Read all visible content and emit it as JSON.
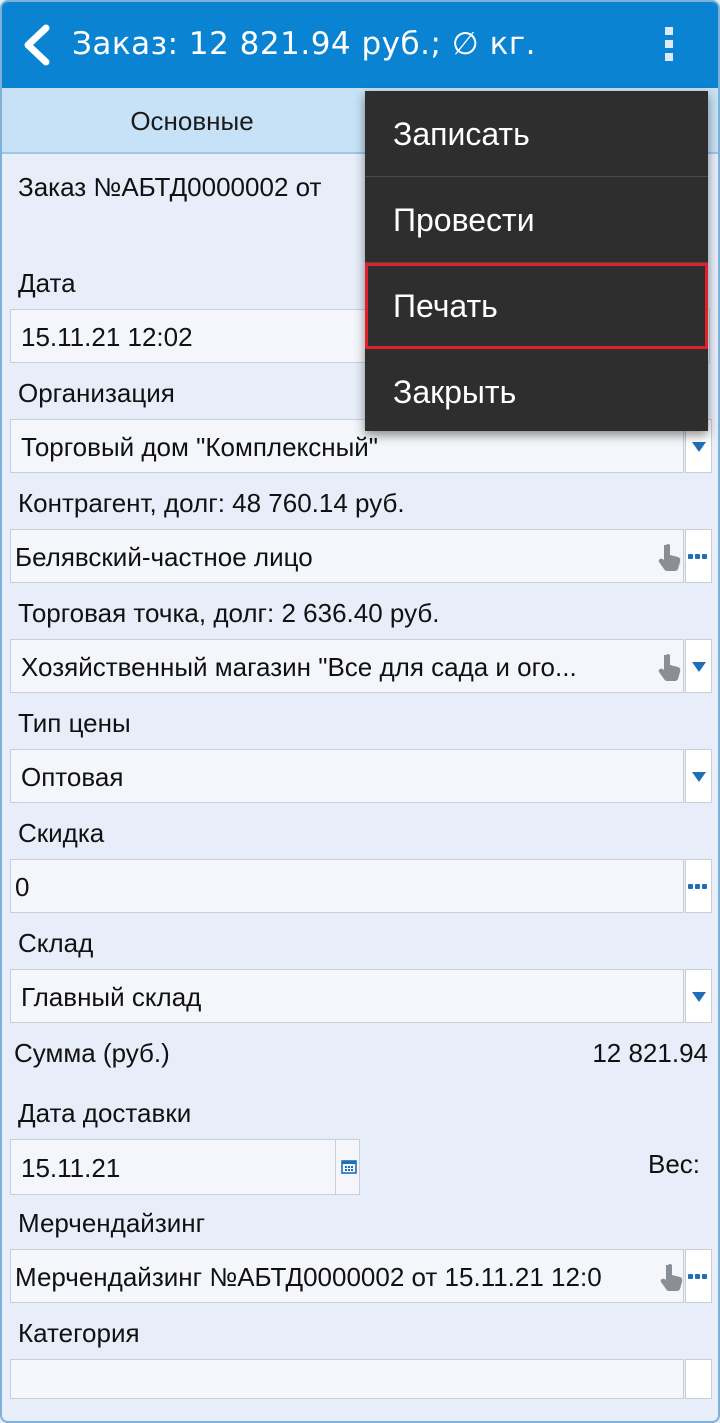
{
  "appbar": {
    "title": "Заказ: 12 821.94 руб.; ∅ кг.",
    "back_icon": "chevron-left-icon",
    "overflow_icon": "kebab-menu-icon"
  },
  "tabs": {
    "main": "Основные"
  },
  "order_title": "Заказ №АБТД0000002 от",
  "fields": {
    "date": {
      "label": "Дата",
      "value": "15.11.21 12:02"
    },
    "organization": {
      "label": "Организация",
      "value": "Торговый дом \"Комплексный\""
    },
    "counterparty": {
      "label": "Контрагент, долг: 48 760.14 руб.",
      "value": "Белявский-частное лицо"
    },
    "outlet": {
      "label": "Торговая точка, долг: 2 636.40 руб.",
      "value": "Хозяйственный магазин \"Все для сада и ого..."
    },
    "price_type": {
      "label": "Тип цены",
      "value": "Оптовая"
    },
    "discount": {
      "label": "Скидка",
      "value": "0"
    },
    "warehouse": {
      "label": "Склад",
      "value": "Главный склад"
    },
    "sum": {
      "label": "Сумма (руб.)",
      "value": "12 821.94"
    },
    "delivery_date": {
      "label": "Дата доставки",
      "value": "15.11.21"
    },
    "weight": {
      "label": "Вес:"
    },
    "merch": {
      "label": "Мерчендайзинг",
      "value": "Мерчендайзинг №АБТД0000002 от 15.11.21 12:0"
    },
    "category": {
      "label": "Категория",
      "value": ""
    }
  },
  "menu": {
    "items": [
      "Записать",
      "Провести",
      "Печать",
      "Закрыть"
    ],
    "selected_index": 2,
    "highlight_color": "#e0202a"
  },
  "colors": {
    "appbar": "#0a84d2",
    "tabs": "#c7e2f6",
    "accent": "#1f6fb6",
    "menu_bg": "#2e2e2e"
  }
}
